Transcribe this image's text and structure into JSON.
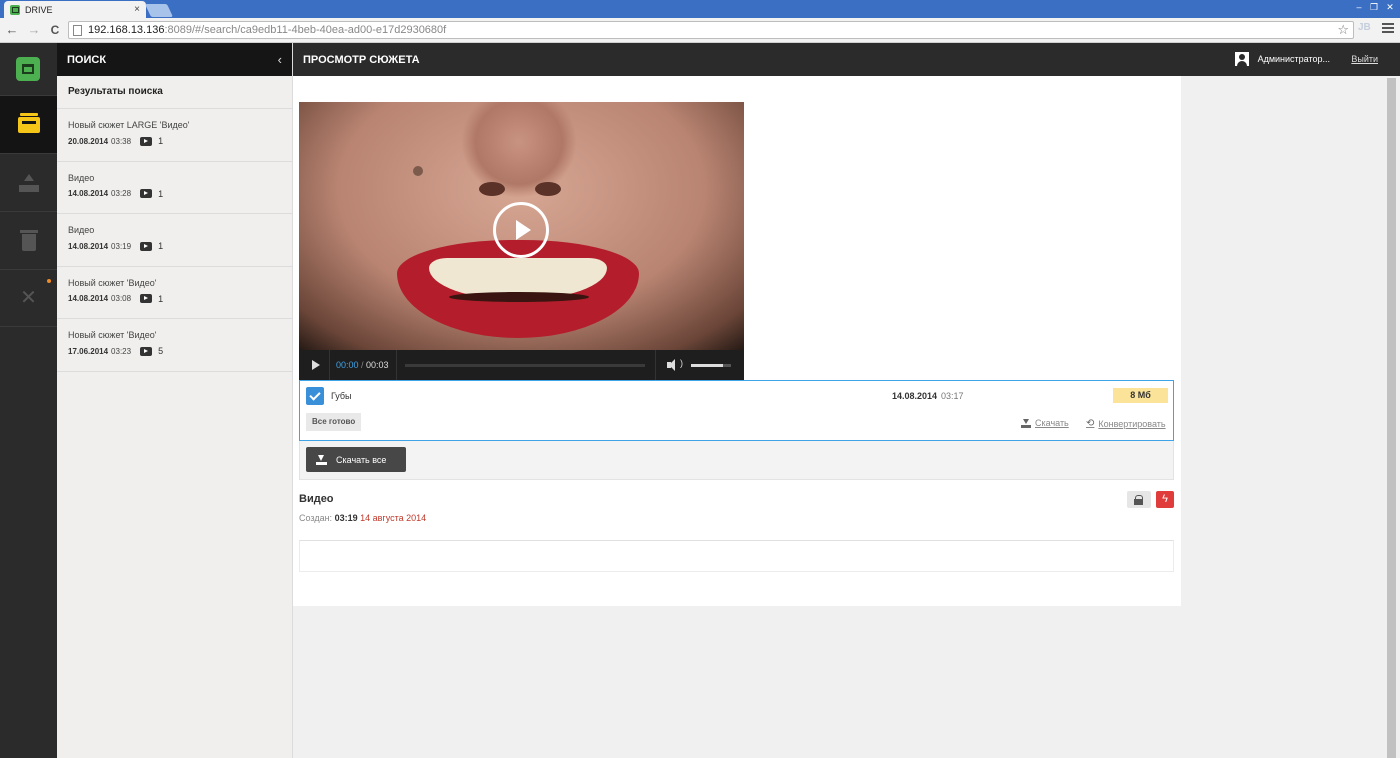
{
  "browser": {
    "tab_title": "DRIVE",
    "tab_close": "×",
    "url_host": "192.168.13.136",
    "url_rest": ":8089/#/search/ca9edb11-4beb-40ea-ad00-e17d2930680f",
    "nav_back": "←",
    "nav_forward": "→",
    "nav_reload": "C",
    "star": "☆",
    "ext_label": "JB"
  },
  "rail": {
    "items": [
      {
        "name": "archive",
        "icon": "archive-icon",
        "active": true
      },
      {
        "name": "upload",
        "icon": "upload-icon",
        "active": false
      },
      {
        "name": "trash",
        "icon": "trash-icon",
        "active": false
      },
      {
        "name": "settings",
        "icon": "tools-icon",
        "active": false,
        "notification": true
      }
    ]
  },
  "search_panel": {
    "title": "ПОИСК",
    "collapse": "‹",
    "results_title": "Результаты поиска",
    "results": [
      {
        "name": "Новый сюжет LARGE 'Видео'",
        "date": "20.08.2014",
        "time": "03:38",
        "count": "1"
      },
      {
        "name": "Видео",
        "date": "14.08.2014",
        "time": "03:28",
        "count": "1"
      },
      {
        "name": "Видео",
        "date": "14.08.2014",
        "time": "03:19",
        "count": "1"
      },
      {
        "name": "Новый сюжет 'Видео'",
        "date": "14.08.2014",
        "time": "03:08",
        "count": "1"
      },
      {
        "name": "Новый сюжет 'Видео'",
        "date": "17.06.2014",
        "time": "03:23",
        "count": "5"
      }
    ]
  },
  "header": {
    "title": "ПРОСМОТР СЮЖЕТА",
    "user": "Администратор...",
    "logout": "Выйти"
  },
  "player": {
    "current_time": "00:00",
    "separator": "/",
    "duration": "00:03",
    "progress": 0,
    "volume": 0.8,
    "volume_waves": ")"
  },
  "file": {
    "name": "Губы",
    "date": "14.08.2014",
    "time": "03:17",
    "size": "8 Мб",
    "status": "Все готово",
    "download": "Скачать",
    "convert": "Конвертировать",
    "convert_icon": "⟲",
    "checked": true
  },
  "download_all": "Скачать все",
  "story": {
    "title": "Видео",
    "created_label": "Создан:",
    "created_time": "03:19",
    "created_date": "14 августа 2014",
    "flash_icon": "ϟ"
  },
  "colors": {
    "accent": "#3fa3e8",
    "logo": "#4caf50",
    "size_badge": "#fbe49a",
    "danger": "#e03c3c"
  }
}
